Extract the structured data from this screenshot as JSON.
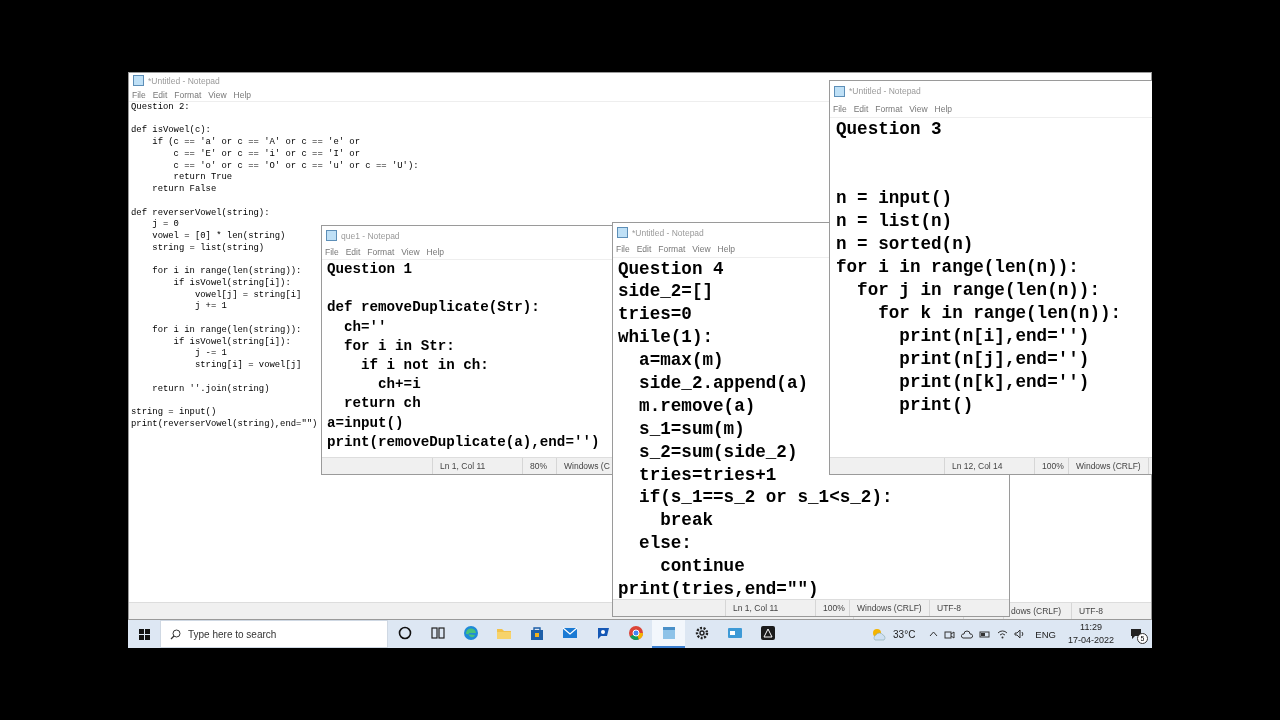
{
  "windows": [
    {
      "title": "*Untitled - Notepad",
      "menu": [
        "File",
        "Edit",
        "Format",
        "View",
        "Help"
      ],
      "blocks": [
        {
          "gap_before": false,
          "wide_gap": false,
          "lines": [
            "Question 2:"
          ]
        },
        {
          "gap_before": true,
          "wide_gap": false,
          "lines": [
            "def isVowel(c):",
            "    if (c == 'a' or c == 'A' or c == 'e' or",
            "        c == 'E' or c == 'i' or c == 'I' or",
            "        c == 'o' or c == 'O' or c == 'u' or c == 'U'):",
            "        return True",
            "    return False"
          ]
        },
        {
          "gap_before": true,
          "wide_gap": false,
          "lines": [
            "def reverserVowel(string):",
            "    j = 0",
            "    vowel = [0] * len(string)",
            "    string = list(string)"
          ]
        },
        {
          "gap_before": true,
          "wide_gap": false,
          "lines": [
            "    for i in range(len(string)):",
            "        if isVowel(string[i]):",
            "            vowel[j] = string[i]",
            "            j += 1"
          ]
        },
        {
          "gap_before": true,
          "wide_gap": false,
          "lines": [
            "    for i in range(len(string)):",
            "        if isVowel(string[i]):",
            "            j -= 1",
            "            string[i] = vowel[j]"
          ]
        },
        {
          "gap_before": true,
          "wide_gap": false,
          "lines": [
            "    return ''.join(string)"
          ]
        },
        {
          "gap_before": true,
          "wide_gap": false,
          "lines": [
            "string = input()",
            "print(reverserVowel(string),end=\"\")"
          ]
        }
      ],
      "status": {
        "line_ending": "dows (CRLF)",
        "encoding": "UTF-8"
      }
    },
    {
      "title": "que1 - Notepad",
      "menu": [
        "File",
        "Edit",
        "Format",
        "View",
        "Help"
      ],
      "blocks": [
        {
          "gap_before": false,
          "wide_gap": false,
          "lines": [
            "Question 1"
          ]
        },
        {
          "gap_before": true,
          "wide_gap": false,
          "lines": [
            "def removeDuplicate(Str):",
            "  ch=''",
            "  for i in Str:",
            "    if i not in ch:",
            "      ch+=i",
            "  return ch",
            "a=input()",
            "print(removeDuplicate(a),end='')"
          ]
        }
      ],
      "status": {
        "position": "Ln 1, Col 11",
        "zoom": "80%",
        "line_ending": "Windows (C"
      }
    },
    {
      "title": "*Untitled - Notepad",
      "menu": [
        "File",
        "Edit",
        "Format",
        "View",
        "Help"
      ],
      "blocks": [
        {
          "gap_before": false,
          "wide_gap": false,
          "lines": [
            "Question 4",
            "side_2=[]",
            "tries=0",
            "while(1):",
            "  a=max(m)",
            "  side_2.append(a)",
            "  m.remove(a)",
            "  s_1=sum(m)",
            "  s_2=sum(side_2)",
            "  tries=tries+1",
            "  if(s_1==s_2 or s_1<s_2):",
            "    break",
            "  else:",
            "    continue",
            "print(tries,end=\"\")"
          ]
        }
      ],
      "status": {
        "position": "Ln 1, Col 11",
        "zoom": "100%",
        "line_ending": "Windows (CRLF)",
        "encoding": "UTF-8"
      }
    },
    {
      "title": "*Untitled - Notepad",
      "menu": [
        "File",
        "Edit",
        "Format",
        "View",
        "Help"
      ],
      "blocks": [
        {
          "gap_before": false,
          "wide_gap": false,
          "lines": [
            "Question 3"
          ]
        },
        {
          "gap_before": true,
          "wide_gap": true,
          "lines": [
            "n = input()",
            "n = list(n)",
            "n = sorted(n)",
            "for i in range(len(n)):",
            "  for j in range(len(n)):",
            "    for k in range(len(n)):",
            "      print(n[i],end='')",
            "      print(n[j],end='')",
            "      print(n[k],end='')",
            "      print()"
          ]
        }
      ],
      "status": {
        "position": "Ln 12, Col 14",
        "zoom": "100%",
        "line_ending": "Windows (CRLF)"
      }
    }
  ],
  "taskbar": {
    "search": {
      "placeholder": "Type here to search"
    },
    "apps": [
      {
        "kind": "cortana",
        "selected": false
      },
      {
        "kind": "taskview",
        "selected": false
      },
      {
        "kind": "edge",
        "selected": false
      },
      {
        "kind": "folder",
        "selected": false
      },
      {
        "kind": "store",
        "selected": false
      },
      {
        "kind": "mail",
        "selected": false
      },
      {
        "kind": "chat",
        "selected": false
      },
      {
        "kind": "chrome",
        "selected": false
      },
      {
        "kind": "notepad",
        "selected": true
      },
      {
        "kind": "settings",
        "selected": false
      },
      {
        "kind": "card",
        "selected": false
      },
      {
        "kind": "triangle",
        "selected": false
      }
    ],
    "temperature": "33°C",
    "language": "ENG",
    "time": "11:29",
    "date": "17-04-2022",
    "notification_count": "5"
  }
}
